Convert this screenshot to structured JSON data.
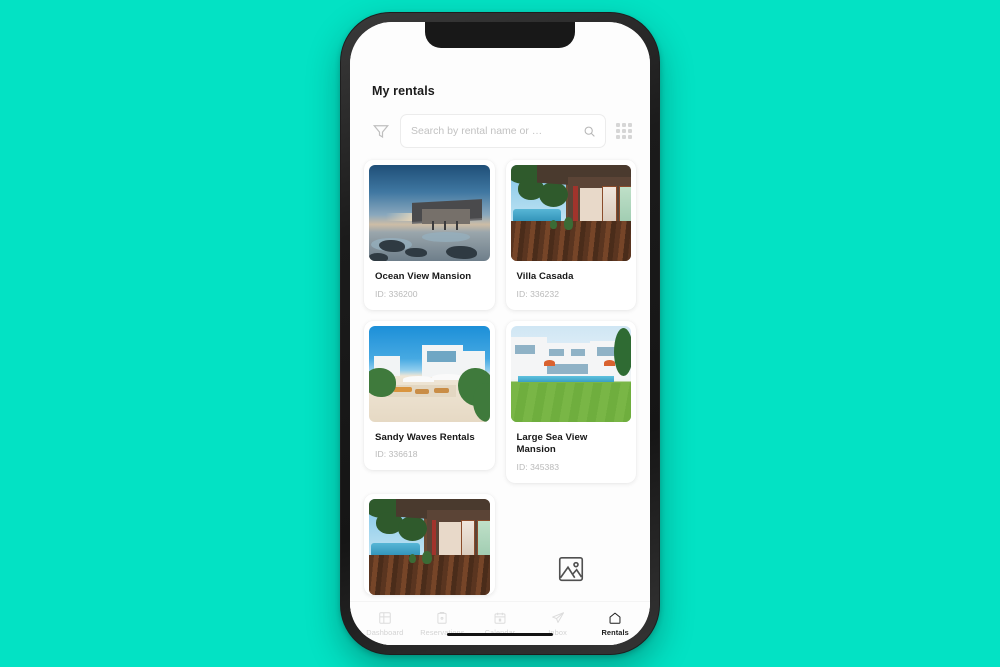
{
  "background_color": "#03e2c4",
  "device": {
    "frame_color": "#1e1e1e",
    "screen_background": "#fdfdfd",
    "notch": "notch",
    "home_indicator": "home-indicator"
  },
  "header": {
    "title": "My rentals"
  },
  "toolbar": {
    "filter_icon": "filter-funnel-icon",
    "grid_view_icon": "grid-dots-icon",
    "search": {
      "placeholder": "Search by rental name or …",
      "value": "",
      "icon": "search-icon"
    }
  },
  "rentals": [
    {
      "name": "Ocean View Mansion",
      "id_label": "ID: 336200",
      "photo": "beach-house-at-dusk",
      "scene": "ocean"
    },
    {
      "name": "Villa Casada",
      "id_label": "ID: 336232",
      "photo": "tropical-villa-deck",
      "scene": "villa"
    },
    {
      "name": "Sandy Waves Rentals",
      "id_label": "ID: 336618",
      "photo": "white-villa-on-beach",
      "scene": "sandy"
    },
    {
      "name": "Large Sea View Mansion",
      "id_label": "ID: 345383",
      "photo": "large-white-mansion-with-pool",
      "scene": "large"
    },
    {
      "name": "",
      "id_label": "",
      "photo": "tropical-villa-deck",
      "scene": "villa"
    }
  ],
  "placeholder_card": {
    "icon": "image-placeholder-icon"
  },
  "tabbar": {
    "items": [
      {
        "label": "Dashboard",
        "icon": "dashboard-grid-icon",
        "active": false
      },
      {
        "label": "Reservations",
        "icon": "reservations-door-icon",
        "active": false
      },
      {
        "label": "Calendar",
        "icon": "calendar-icon",
        "active": false
      },
      {
        "label": "Inbox",
        "icon": "paper-plane-icon",
        "active": false
      },
      {
        "label": "Rentals",
        "icon": "home-icon",
        "active": true
      }
    ]
  }
}
